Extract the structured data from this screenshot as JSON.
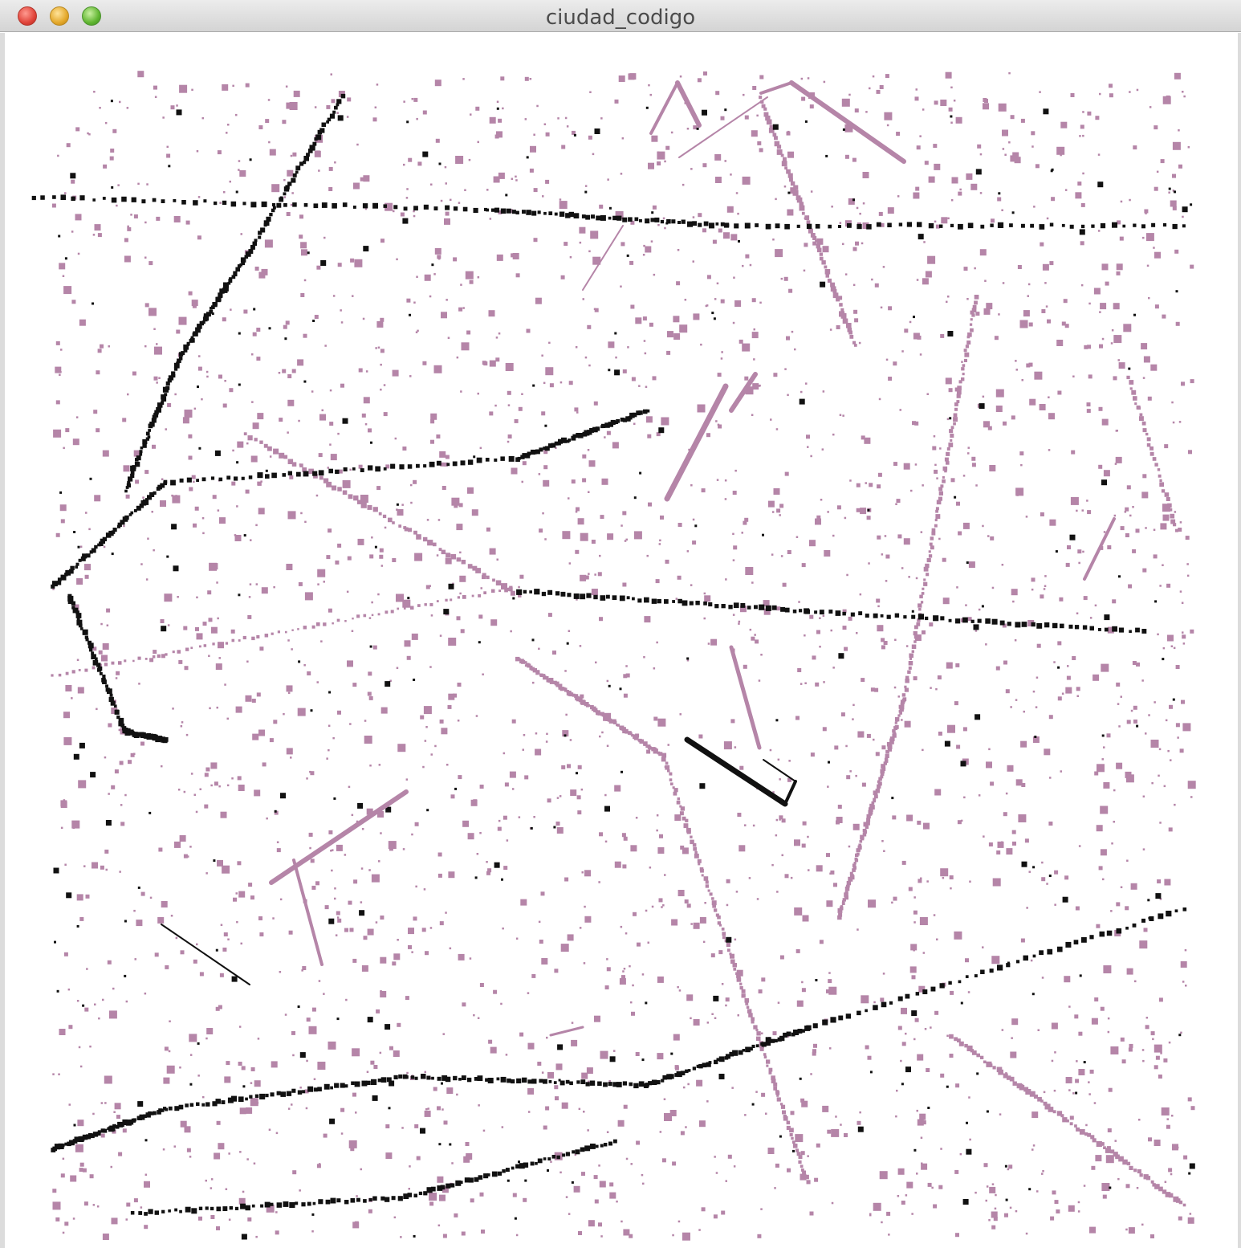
{
  "window": {
    "title": "ciudad_codigo"
  },
  "colors": {
    "accent_pink": "#b585a8",
    "black": "#111111",
    "background": "#ffffff"
  },
  "canvas": {
    "content": "generative-dot-field"
  }
}
